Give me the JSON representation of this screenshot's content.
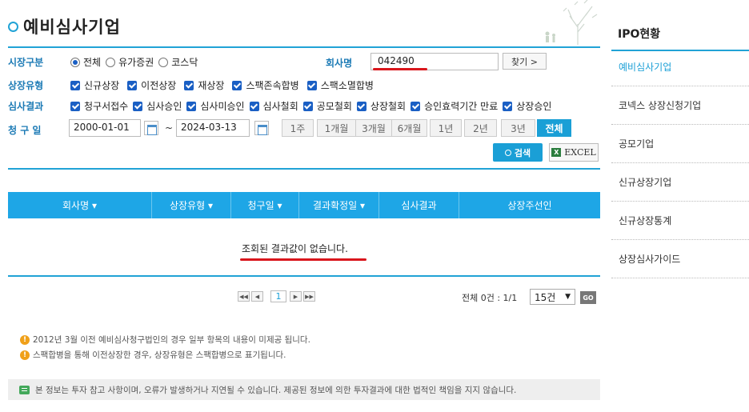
{
  "page_title": "예비심사기업",
  "filters": {
    "market_label": "시장구분",
    "market_options": [
      "전체",
      "유가증권",
      "코스닥"
    ],
    "company_label": "회사명",
    "company_value": "042490",
    "find_label": "찾기 >",
    "listing_type_label": "상장유형",
    "listing_types": [
      "신규상장",
      "이전상장",
      "재상장",
      "스팩존속합병",
      "스팩소멸합병"
    ],
    "review_label": "심사결과",
    "review_results": [
      "청구서접수",
      "심사승인",
      "심사미승인",
      "심사철회",
      "공모철회",
      "상장철회",
      "승인효력기간 만료",
      "상장승인"
    ],
    "date_label": "청 구 일",
    "date_from": "2000-01-01",
    "date_sep": "~",
    "date_to": "2024-03-13",
    "periods": [
      "1주",
      "1개월",
      "3개월",
      "6개월",
      "1년",
      "2년",
      "3년",
      "전체"
    ]
  },
  "actions": {
    "search_label": "검색",
    "excel_label": "EXCEL"
  },
  "table": {
    "headers": [
      "회사명 ▾",
      "상장유형 ▾",
      "청구일 ▾",
      "결과확정일 ▾",
      "심사결과",
      "상장주선인"
    ],
    "empty_message": "조회된 결과값이 없습니다."
  },
  "pagination": {
    "current_page": "1",
    "total_text": "전체 0건 : 1/1",
    "page_size": "15건",
    "go_label": "GO"
  },
  "notes": [
    "2012년 3월 이전 예비심사청구법인의 경우 일부 항목의 내용이 미제공 됩니다.",
    "스팩합병을 통해 이전상장한 경우, 상장유형은 스팩합병으로 표기됩니다."
  ],
  "disclaimer": "본 정보는 투자 참고 사항이며, 오류가 발생하거나 지연될 수 있습니다. 제공된 정보에 의한 투자결과에 대한 법적인 책임을 지지 않습니다.",
  "sidebar": {
    "title": "IPO현황",
    "items": [
      "예비심사기업",
      "코넥스 상장신청기업",
      "공모기업",
      "신규상장기업",
      "신규상장통계",
      "상장심사가이드"
    ]
  },
  "colors": {
    "accent": "#21a3d6",
    "header_bg": "#1ea6e6",
    "checkbox": "#1a5fc4",
    "highlight": "#d9161c"
  }
}
